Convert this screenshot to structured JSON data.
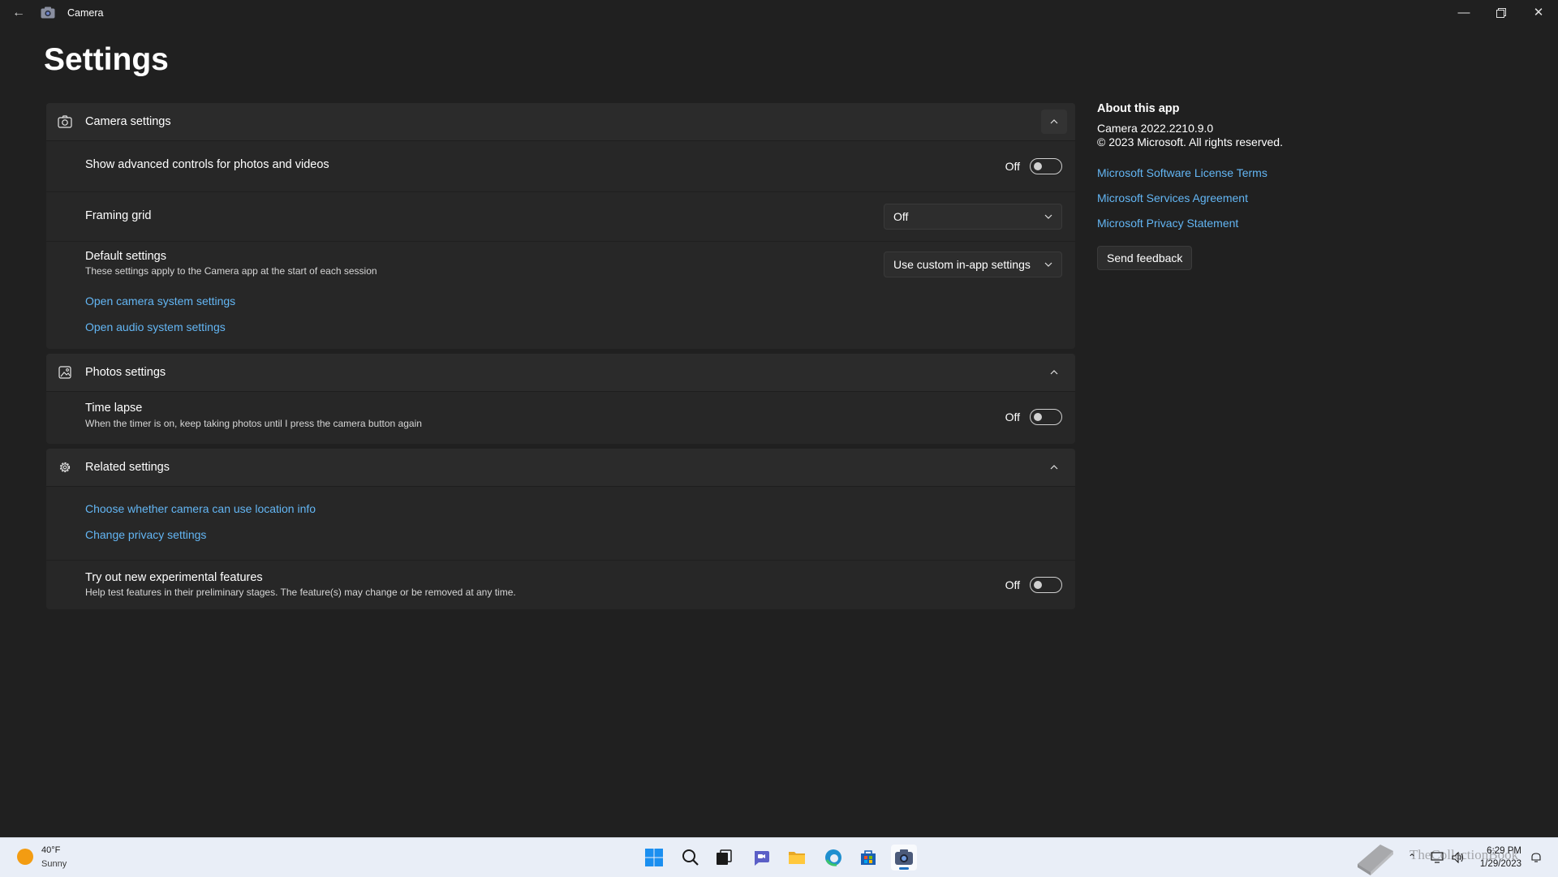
{
  "window": {
    "title": "Camera",
    "back_icon": "arrow-left-icon",
    "controls": [
      "minimize-icon",
      "restore-icon",
      "close-icon"
    ]
  },
  "page": {
    "title": "Settings"
  },
  "camera_settings": {
    "header": "Camera settings",
    "icon": "camera-icon",
    "advanced": {
      "label": "Show advanced controls for photos and videos",
      "state": "Off"
    },
    "framing": {
      "label": "Framing grid",
      "value": "Off"
    },
    "defaults": {
      "label": "Default settings",
      "description": "These settings apply to the Camera app at the start of each session",
      "value": "Use custom in-app settings"
    },
    "links": [
      "Open camera system settings",
      "Open audio system settings"
    ]
  },
  "photos_settings": {
    "header": "Photos settings",
    "icon": "photo-icon",
    "time_lapse": {
      "label": "Time lapse",
      "description": "When the timer is on, keep taking photos until I press the camera button again",
      "state": "Off"
    }
  },
  "related_settings": {
    "header": "Related settings",
    "icon": "gear-icon",
    "links": [
      "Choose whether camera can use location info",
      "Change privacy settings"
    ],
    "experimental": {
      "label": "Try out new experimental features",
      "description": "Help test features in their preliminary stages. The feature(s) may change or be removed at any time.",
      "state": "Off"
    }
  },
  "about": {
    "title": "About this app",
    "version_line": "Camera  2022.2210.9.0",
    "copyright": "© 2023 Microsoft. All rights reserved.",
    "links": [
      "Microsoft Software License Terms",
      "Microsoft Services Agreement",
      "Microsoft Privacy Statement"
    ],
    "feedback_label": "Send feedback"
  },
  "taskbar": {
    "weather": {
      "temp": "40°F",
      "condition": "Sunny"
    },
    "apps": [
      "windows-start-icon",
      "search-icon",
      "task-view-icon",
      "chat-icon",
      "file-explorer-icon",
      "edge-icon",
      "store-icon",
      "camera-app-icon"
    ],
    "clock": {
      "time": "6:29 PM",
      "date": "1/29/2023"
    },
    "watermark": "TheCollectionBook"
  },
  "colors": {
    "background": "#202020",
    "card": "#272727",
    "card_header": "#2b2b2b",
    "link": "#63b6f4",
    "taskbar": "#e9eef7"
  }
}
